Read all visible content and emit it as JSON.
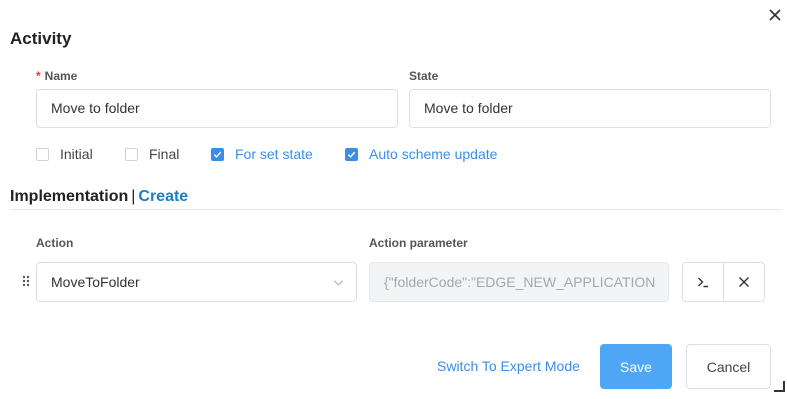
{
  "dialog": {
    "title": "Activity",
    "close_icon": "close-icon"
  },
  "fields": {
    "name": {
      "required_mark": "*",
      "label": "Name",
      "value": "Move to folder"
    },
    "state": {
      "label": "State",
      "value": "Move to folder"
    }
  },
  "checkboxes": [
    {
      "label": "Initial",
      "checked": false
    },
    {
      "label": "Final",
      "checked": false
    },
    {
      "label": "For set state",
      "checked": true
    },
    {
      "label": "Auto scheme update",
      "checked": true
    }
  ],
  "implementation": {
    "title": "Implementation",
    "separator": "|",
    "create_link": "Create",
    "action_label": "Action",
    "action_value": "MoveToFolder",
    "param_label": "Action parameter",
    "param_value": "{\"folderCode\":\"EDGE_NEW_APPLICATION",
    "icons": [
      "drag-handle-icon",
      "chevron-down-icon",
      "terminal-icon",
      "close-icon"
    ]
  },
  "footer": {
    "expert_mode_link": "Switch To Expert Mode",
    "save_label": "Save",
    "cancel_label": "Cancel"
  },
  "colors": {
    "accent": "#3b8ee8",
    "save_button": "#4ea6f5",
    "link": "#1a7fc6",
    "required": "#e03c3c"
  }
}
